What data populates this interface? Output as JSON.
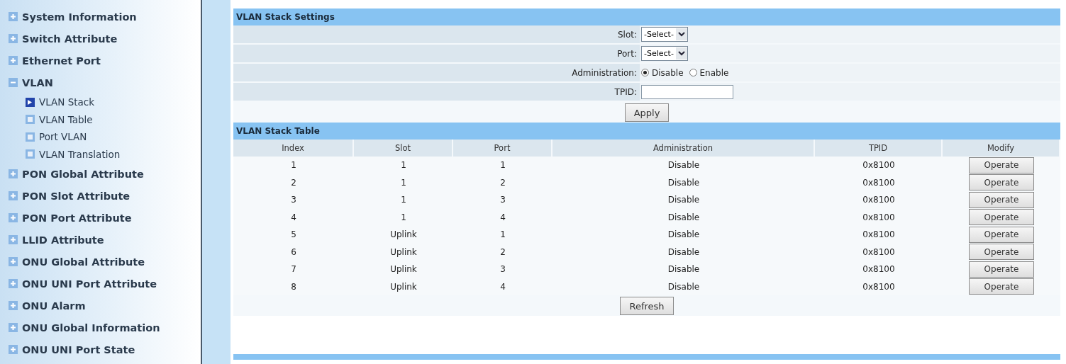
{
  "sidebar": {
    "items": [
      {
        "label": "System Information",
        "expanded": false
      },
      {
        "label": "Switch Attribute",
        "expanded": false
      },
      {
        "label": "Ethernet Port",
        "expanded": false
      },
      {
        "label": "VLAN",
        "expanded": true,
        "children": [
          {
            "label": "VLAN Stack",
            "selected": true
          },
          {
            "label": "VLAN Table",
            "selected": false
          },
          {
            "label": "Port VLAN",
            "selected": false
          },
          {
            "label": "VLAN Translation",
            "selected": false
          }
        ]
      },
      {
        "label": "PON Global Attribute",
        "expanded": false
      },
      {
        "label": "PON Slot Attribute",
        "expanded": false
      },
      {
        "label": "PON Port Attribute",
        "expanded": false
      },
      {
        "label": "LLID Attribute",
        "expanded": false
      },
      {
        "label": "ONU Global Attribute",
        "expanded": false
      },
      {
        "label": "ONU UNI Port Attribute",
        "expanded": false
      },
      {
        "label": "ONU Alarm",
        "expanded": false
      },
      {
        "label": "ONU Global Information",
        "expanded": false
      },
      {
        "label": "ONU UNI Port State",
        "expanded": false
      }
    ]
  },
  "settings": {
    "title": "VLAN Stack Settings",
    "fields": [
      {
        "kind": "select",
        "label": "Slot:",
        "value": "-Select-"
      },
      {
        "kind": "select",
        "label": "Port:",
        "value": "-Select-"
      },
      {
        "kind": "radio",
        "label": "Administration:",
        "options": [
          {
            "label": "Disable",
            "selected": true
          },
          {
            "label": "Enable",
            "selected": false
          }
        ]
      },
      {
        "kind": "text",
        "label": "TPID:"
      }
    ],
    "button": "Apply"
  },
  "table": {
    "title": "VLAN Stack Table",
    "columns": [
      "Index",
      "Slot",
      "Port",
      "Administration",
      "TPID",
      "Modify"
    ],
    "rows": [
      [
        "1",
        "1",
        "1",
        "Disable",
        "0x8100",
        "Operate"
      ],
      [
        "2",
        "1",
        "2",
        "Disable",
        "0x8100",
        "Operate"
      ],
      [
        "3",
        "1",
        "3",
        "Disable",
        "0x8100",
        "Operate"
      ],
      [
        "4",
        "1",
        "4",
        "Disable",
        "0x8100",
        "Operate"
      ],
      [
        "5",
        "Uplink",
        "1",
        "Disable",
        "0x8100",
        "Operate"
      ],
      [
        "6",
        "Uplink",
        "2",
        "Disable",
        "0x8100",
        "Operate"
      ],
      [
        "7",
        "Uplink",
        "3",
        "Disable",
        "0x8100",
        "Operate"
      ],
      [
        "8",
        "Uplink",
        "4",
        "Disable",
        "0x8100",
        "Operate"
      ]
    ],
    "button": "Refresh"
  }
}
